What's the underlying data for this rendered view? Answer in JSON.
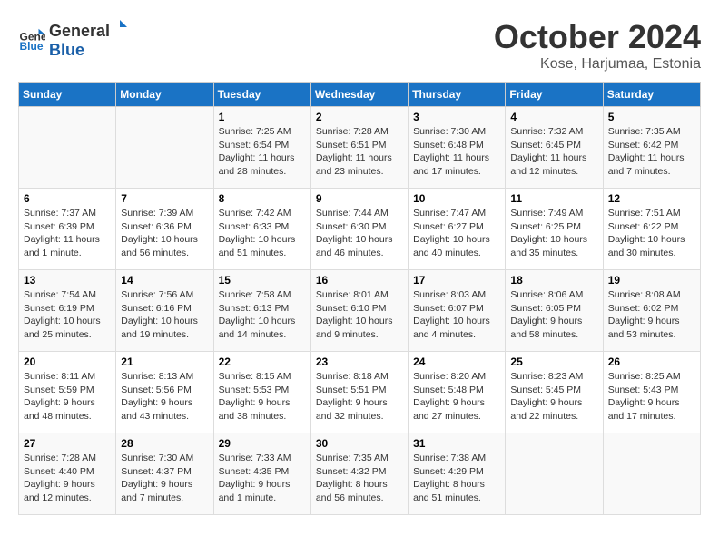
{
  "logo": {
    "general": "General",
    "blue": "Blue"
  },
  "title": "October 2024",
  "subtitle": "Kose, Harjumaa, Estonia",
  "weekdays": [
    "Sunday",
    "Monday",
    "Tuesday",
    "Wednesday",
    "Thursday",
    "Friday",
    "Saturday"
  ],
  "weeks": [
    [
      {
        "day": "",
        "info": ""
      },
      {
        "day": "",
        "info": ""
      },
      {
        "day": "1",
        "info": "Sunrise: 7:25 AM\nSunset: 6:54 PM\nDaylight: 11 hours and 28 minutes."
      },
      {
        "day": "2",
        "info": "Sunrise: 7:28 AM\nSunset: 6:51 PM\nDaylight: 11 hours and 23 minutes."
      },
      {
        "day": "3",
        "info": "Sunrise: 7:30 AM\nSunset: 6:48 PM\nDaylight: 11 hours and 17 minutes."
      },
      {
        "day": "4",
        "info": "Sunrise: 7:32 AM\nSunset: 6:45 PM\nDaylight: 11 hours and 12 minutes."
      },
      {
        "day": "5",
        "info": "Sunrise: 7:35 AM\nSunset: 6:42 PM\nDaylight: 11 hours and 7 minutes."
      }
    ],
    [
      {
        "day": "6",
        "info": "Sunrise: 7:37 AM\nSunset: 6:39 PM\nDaylight: 11 hours and 1 minute."
      },
      {
        "day": "7",
        "info": "Sunrise: 7:39 AM\nSunset: 6:36 PM\nDaylight: 10 hours and 56 minutes."
      },
      {
        "day": "8",
        "info": "Sunrise: 7:42 AM\nSunset: 6:33 PM\nDaylight: 10 hours and 51 minutes."
      },
      {
        "day": "9",
        "info": "Sunrise: 7:44 AM\nSunset: 6:30 PM\nDaylight: 10 hours and 46 minutes."
      },
      {
        "day": "10",
        "info": "Sunrise: 7:47 AM\nSunset: 6:27 PM\nDaylight: 10 hours and 40 minutes."
      },
      {
        "day": "11",
        "info": "Sunrise: 7:49 AM\nSunset: 6:25 PM\nDaylight: 10 hours and 35 minutes."
      },
      {
        "day": "12",
        "info": "Sunrise: 7:51 AM\nSunset: 6:22 PM\nDaylight: 10 hours and 30 minutes."
      }
    ],
    [
      {
        "day": "13",
        "info": "Sunrise: 7:54 AM\nSunset: 6:19 PM\nDaylight: 10 hours and 25 minutes."
      },
      {
        "day": "14",
        "info": "Sunrise: 7:56 AM\nSunset: 6:16 PM\nDaylight: 10 hours and 19 minutes."
      },
      {
        "day": "15",
        "info": "Sunrise: 7:58 AM\nSunset: 6:13 PM\nDaylight: 10 hours and 14 minutes."
      },
      {
        "day": "16",
        "info": "Sunrise: 8:01 AM\nSunset: 6:10 PM\nDaylight: 10 hours and 9 minutes."
      },
      {
        "day": "17",
        "info": "Sunrise: 8:03 AM\nSunset: 6:07 PM\nDaylight: 10 hours and 4 minutes."
      },
      {
        "day": "18",
        "info": "Sunrise: 8:06 AM\nSunset: 6:05 PM\nDaylight: 9 hours and 58 minutes."
      },
      {
        "day": "19",
        "info": "Sunrise: 8:08 AM\nSunset: 6:02 PM\nDaylight: 9 hours and 53 minutes."
      }
    ],
    [
      {
        "day": "20",
        "info": "Sunrise: 8:11 AM\nSunset: 5:59 PM\nDaylight: 9 hours and 48 minutes."
      },
      {
        "day": "21",
        "info": "Sunrise: 8:13 AM\nSunset: 5:56 PM\nDaylight: 9 hours and 43 minutes."
      },
      {
        "day": "22",
        "info": "Sunrise: 8:15 AM\nSunset: 5:53 PM\nDaylight: 9 hours and 38 minutes."
      },
      {
        "day": "23",
        "info": "Sunrise: 8:18 AM\nSunset: 5:51 PM\nDaylight: 9 hours and 32 minutes."
      },
      {
        "day": "24",
        "info": "Sunrise: 8:20 AM\nSunset: 5:48 PM\nDaylight: 9 hours and 27 minutes."
      },
      {
        "day": "25",
        "info": "Sunrise: 8:23 AM\nSunset: 5:45 PM\nDaylight: 9 hours and 22 minutes."
      },
      {
        "day": "26",
        "info": "Sunrise: 8:25 AM\nSunset: 5:43 PM\nDaylight: 9 hours and 17 minutes."
      }
    ],
    [
      {
        "day": "27",
        "info": "Sunrise: 7:28 AM\nSunset: 4:40 PM\nDaylight: 9 hours and 12 minutes."
      },
      {
        "day": "28",
        "info": "Sunrise: 7:30 AM\nSunset: 4:37 PM\nDaylight: 9 hours and 7 minutes."
      },
      {
        "day": "29",
        "info": "Sunrise: 7:33 AM\nSunset: 4:35 PM\nDaylight: 9 hours and 1 minute."
      },
      {
        "day": "30",
        "info": "Sunrise: 7:35 AM\nSunset: 4:32 PM\nDaylight: 8 hours and 56 minutes."
      },
      {
        "day": "31",
        "info": "Sunrise: 7:38 AM\nSunset: 4:29 PM\nDaylight: 8 hours and 51 minutes."
      },
      {
        "day": "",
        "info": ""
      },
      {
        "day": "",
        "info": ""
      }
    ]
  ]
}
